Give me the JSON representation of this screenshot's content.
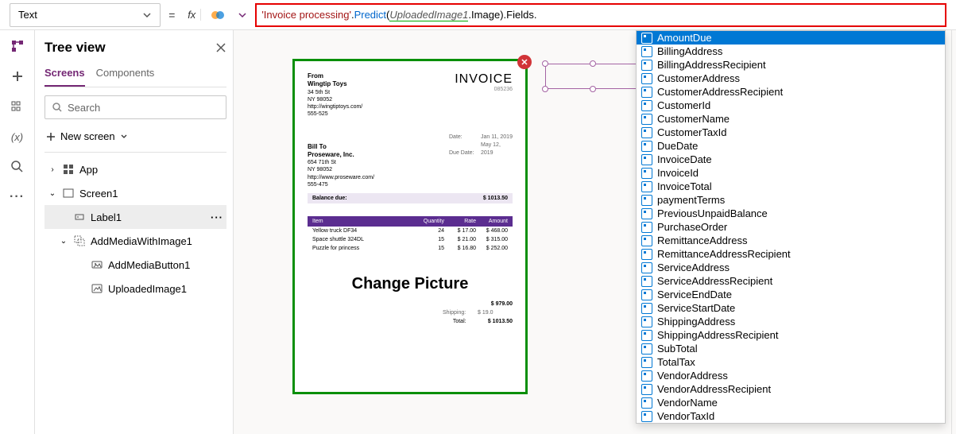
{
  "formulaBar": {
    "property": "Text",
    "fxLabel": "fx",
    "formula": {
      "string": "'Invoice processing'",
      "method": "Predict",
      "param": "UploadedImage1",
      "imageProp": "Image",
      "fieldsProp": "Fields"
    }
  },
  "treeView": {
    "title": "Tree view",
    "tabs": {
      "screens": "Screens",
      "components": "Components"
    },
    "searchPlaceholder": "Search",
    "newScreen": "New screen",
    "items": {
      "app": "App",
      "screen1": "Screen1",
      "label1": "Label1",
      "addMedia": "AddMediaWithImage1",
      "addMediaBtn": "AddMediaButton1",
      "uploadedImg": "UploadedImage1"
    }
  },
  "invoice": {
    "from": {
      "label": "From",
      "name": "Wingtip Toys",
      "addr1": "34 5th St",
      "addr2": "NY 98052",
      "web": "http://wingtiptoys.com/",
      "phone": "555-525"
    },
    "title": "INVOICE",
    "number": "085236",
    "dates": {
      "dateLabel": "Date:",
      "dateVal": "Jan 11, 2019",
      "dueLabel": "Due Date:",
      "dueVal": "May 12, 2019"
    },
    "billTo": {
      "label": "Bill To",
      "name": "Proseware, Inc.",
      "addr1": "654 71th St",
      "addr2": "NY 98052",
      "web": "http://www.proseware.com/",
      "phone": "555-475"
    },
    "balance": {
      "label": "Balance due:",
      "val": "$ 1013.50"
    },
    "headers": {
      "item": "Item",
      "qty": "Quantity",
      "rate": "Rate",
      "amt": "Amount"
    },
    "lines": [
      {
        "item": "Yellow truck DF34",
        "qty": "24",
        "rate": "$ 17.00",
        "amt": "$ 468.00"
      },
      {
        "item": "Space shuttle 324DL",
        "qty": "15",
        "rate": "$ 21.00",
        "amt": "$ 315.00"
      },
      {
        "item": "Puzzle for princess",
        "qty": "15",
        "rate": "$ 16.80",
        "amt": "$ 252.00"
      }
    ],
    "changePicture": "Change Picture",
    "totals": {
      "sub": "$ 979.00",
      "shipLabel": "Shipping:",
      "ship": "$ 19.0",
      "totalLabel": "Total:",
      "total": "$ 1013.50"
    }
  },
  "intellisense": {
    "items": [
      "AmountDue",
      "BillingAddress",
      "BillingAddressRecipient",
      "CustomerAddress",
      "CustomerAddressRecipient",
      "CustomerId",
      "CustomerName",
      "CustomerTaxId",
      "DueDate",
      "InvoiceDate",
      "InvoiceId",
      "InvoiceTotal",
      "paymentTerms",
      "PreviousUnpaidBalance",
      "PurchaseOrder",
      "RemittanceAddress",
      "RemittanceAddressRecipient",
      "ServiceAddress",
      "ServiceAddressRecipient",
      "ServiceEndDate",
      "ServiceStartDate",
      "ShippingAddress",
      "ShippingAddressRecipient",
      "SubTotal",
      "TotalTax",
      "VendorAddress",
      "VendorAddressRecipient",
      "VendorName",
      "VendorTaxId"
    ],
    "selectedIndex": 0
  }
}
